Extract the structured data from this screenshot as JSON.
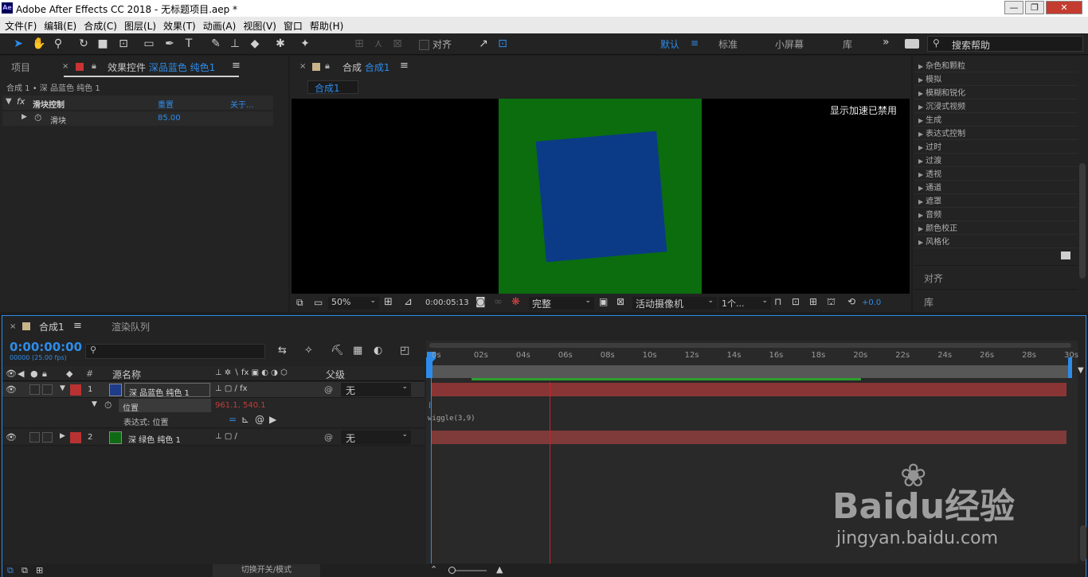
{
  "app": {
    "title": "Adobe After Effects CC 2018 - 无标题项目.aep *",
    "icon_label": "Ae"
  },
  "window_controls": {
    "minimize": "—",
    "restore": "❐",
    "close": "✕"
  },
  "menu": [
    "文件(F)",
    "编辑(E)",
    "合成(C)",
    "图层(L)",
    "效果(T)",
    "动画(A)",
    "视图(V)",
    "窗口",
    "帮助(H)"
  ],
  "toolbar": {
    "snap_label": "对齐",
    "workspaces": [
      "默认",
      "标准",
      "小屏幕",
      "库"
    ],
    "more": "»",
    "search_placeholder": "搜索帮助"
  },
  "project_panel": {
    "tab_project": "项目",
    "tab_effects_prefix": "效果控件",
    "tab_effects_layer": "深品蓝色 纯色1",
    "breadcrumb": "合成 1 • 深 品蓝色 纯色 1",
    "effect_name": "滑块控制",
    "reset": "重置",
    "about": "关于...",
    "slider_label": "滑块",
    "slider_value": "85.00"
  },
  "comp_panel": {
    "tab_prefix": "合成",
    "tab_name": "合成1",
    "subtab": "合成1",
    "gpu_notice": "显示加速已禁用",
    "zoom": "50%",
    "timecode": "0:00:05:13",
    "resolution": "完整",
    "camera": "活动摄像机",
    "views": "1个...",
    "exposure": "+0.0",
    "canvas_bg": "#000000",
    "green_color": "#0b6d0e",
    "blue_color": "#0b3b87",
    "square_rotation_deg": -5
  },
  "effects_list": [
    "杂色和颗粒",
    "模拟",
    "模糊和锐化",
    "沉浸式视频",
    "生成",
    "表达式控制",
    "过时",
    "过渡",
    "透视",
    "通道",
    "遮罩",
    "音频",
    "颜色校正",
    "风格化"
  ],
  "right_panels": {
    "align": "对齐",
    "library": "库"
  },
  "timeline": {
    "tab_name": "合成1",
    "render_queue": "渲染队列",
    "timecode": "0:00:00:00",
    "frames": "00000 (25.00 fps)",
    "col_source": "源名称",
    "col_parent": "父级",
    "layers": [
      {
        "num": "1",
        "name": "深 品蓝色 纯色 1",
        "color": "#1e3c8a",
        "parent": "无",
        "label_color": "#b83232"
      },
      {
        "num": "2",
        "name": "深 绿色 纯色 1",
        "color": "#0f6a14",
        "parent": "无",
        "label_color": "#b83232"
      }
    ],
    "position_label": "位置",
    "position_value": "961.1, 540.1",
    "expression_label": "表达式: 位置",
    "expression_text": "wiggle(3,9)",
    "ruler": [
      "0s",
      "02s",
      "04s",
      "06s",
      "08s",
      "10s",
      "12s",
      "14s",
      "16s",
      "18s",
      "20s",
      "22s",
      "24s",
      "26s",
      "28s",
      "30s"
    ],
    "current_time_s": 5.5,
    "duration_s": 30,
    "toggle_label": "切换开关/模式"
  },
  "watermark": {
    "brand": "Baidu经验",
    "url": "jingyan.baidu.com"
  }
}
